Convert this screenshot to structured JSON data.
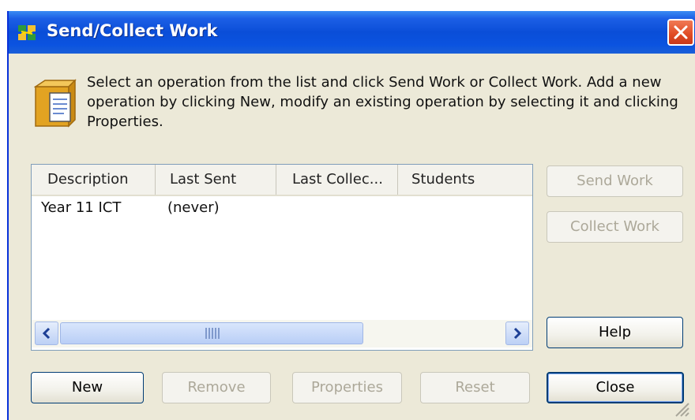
{
  "window": {
    "title": "Send/Collect Work",
    "intro_text": "Select an operation from the list and click Send Work or Collect Work. Add a new operation by clicking New, modify an existing operation by selecting it and clicking Properties."
  },
  "list": {
    "columns": [
      "Description",
      "Last Sent",
      "Last Collec...",
      "Students"
    ],
    "rows": [
      {
        "description": "Year 11 ICT",
        "last_sent": "(never)",
        "last_collected": "",
        "students": ""
      }
    ]
  },
  "buttons": {
    "send_work": "Send Work",
    "collect_work": "Collect Work",
    "help": "Help",
    "new": "New",
    "remove": "Remove",
    "properties": "Properties",
    "reset": "Reset",
    "close": "Close"
  },
  "icons": {
    "title": "send-collect-icon",
    "info": "folder-document-icon",
    "close": "close-icon"
  },
  "colors": {
    "titlebar": "#0a4ed8",
    "close_button": "#e04a23",
    "dialog_bg": "#ece9d8"
  }
}
